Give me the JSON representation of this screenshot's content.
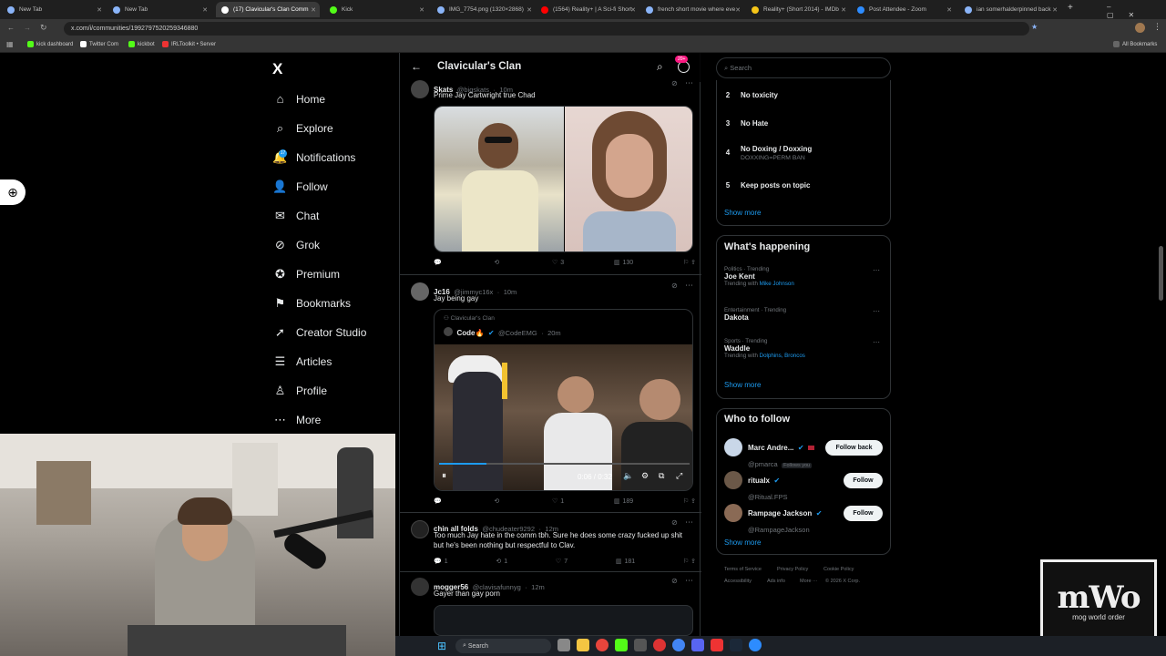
{
  "browser": {
    "tabs": [
      {
        "title": "New Tab",
        "color": "#8ab4f8"
      },
      {
        "title": "New Tab",
        "color": "#8ab4f8"
      },
      {
        "title": "(17) Clavicular's Clan Comm",
        "color": "#ffffff"
      },
      {
        "title": "Kick",
        "color": "#53fc18"
      },
      {
        "title": "IMG_7754.png (1320×2868)",
        "color": "#8ab4f8"
      },
      {
        "title": "(1564) Reality+ | A Sci-fi Short",
        "color": "#ff0000"
      },
      {
        "title": "french short movie where eve",
        "color": "#8ab4f8"
      },
      {
        "title": "Reality+ (Short 2014) - IMDb",
        "color": "#f5c518"
      },
      {
        "title": "Post Attendee - Zoom",
        "color": "#2d8cff"
      },
      {
        "title": "ian somerhalderpinned back",
        "color": "#8ab4f8"
      }
    ],
    "url": "x.com/i/communities/1992797520259346880",
    "bookmarks": [
      "kick dashboard",
      "Twitter Com",
      "kickbot",
      "IRLToolkit • Server"
    ],
    "all_bookmarks": "All Bookmarks"
  },
  "nav": {
    "logo": "X",
    "items": [
      {
        "label": "Home",
        "icon": "home-icon",
        "glyph": "⌂"
      },
      {
        "label": "Explore",
        "icon": "search-icon",
        "glyph": "⌕"
      },
      {
        "label": "Notifications",
        "icon": "bell-icon",
        "glyph": "🔔"
      },
      {
        "label": "Follow",
        "icon": "person-plus-icon",
        "glyph": "👤"
      },
      {
        "label": "Chat",
        "icon": "mail-icon",
        "glyph": "✉"
      },
      {
        "label": "Grok",
        "icon": "grok-icon",
        "glyph": "⊘"
      },
      {
        "label": "Premium",
        "icon": "verified-icon",
        "glyph": "✪"
      },
      {
        "label": "Bookmarks",
        "icon": "bookmark-icon",
        "glyph": "⚑"
      },
      {
        "label": "Creator Studio",
        "icon": "rocket-icon",
        "glyph": "➚"
      },
      {
        "label": "Articles",
        "icon": "document-icon",
        "glyph": "☰"
      },
      {
        "label": "Profile",
        "icon": "person-icon",
        "glyph": "♙"
      },
      {
        "label": "More",
        "icon": "more-icon",
        "glyph": "⋯"
      }
    ],
    "notifications_badge": "17"
  },
  "header": {
    "title": "Clavicular's Clan",
    "badge": "20+"
  },
  "posts": [
    {
      "name": "Skats",
      "handle": "@bigskats",
      "time": "10m",
      "text": "Prime Jay Cartwright true Chad",
      "replies": "",
      "reposts": "",
      "likes": "3",
      "views": "130"
    },
    {
      "name": "Jc16",
      "handle": "@jimmyc16x",
      "time": "10m",
      "text": "Jay being gay",
      "replies": "",
      "reposts": "",
      "likes": "1",
      "views": "189",
      "quote": {
        "community": "Clavicular's Clan",
        "name": "Code🔥",
        "handle": "@CodeEMG",
        "time": "20m",
        "video_time": "0:06 / 0:32"
      }
    },
    {
      "name": "chin all folds",
      "handle": "@chudeater9292",
      "time": "12m",
      "text": "Too much Jay hate in the comm tbh. Sure he does some crazy fucked up shit but he's been nothing but respectful to Clav.",
      "replies": "1",
      "reposts": "1",
      "likes": "7",
      "views": "181"
    },
    {
      "name": "mogger56",
      "handle": "@clavisafunnyg",
      "time": "12m",
      "text": "Gayer than gay porn"
    }
  ],
  "sidebar": {
    "search_placeholder": "Search",
    "rules": [
      {
        "n": "2",
        "title": "No toxicity",
        "sub": ""
      },
      {
        "n": "3",
        "title": "No Hate",
        "sub": ""
      },
      {
        "n": "4",
        "title": "No Doxing / Doxxing",
        "sub": "DOXXING=PERM BAN"
      },
      {
        "n": "5",
        "title": "Keep posts on topic",
        "sub": ""
      }
    ],
    "show_more": "Show more",
    "happening_title": "What's happening",
    "trends": [
      {
        "meta": "Politics · Trending",
        "name": "Joe Kent",
        "with_label": "Trending with ",
        "with": "Mike Johnson"
      },
      {
        "meta": "Entertainment · Trending",
        "name": "Dakota",
        "with_label": "",
        "with": ""
      },
      {
        "meta": "Sports · Trending",
        "name": "Waddle",
        "with_label": "Trending with ",
        "with": "Dolphins, Broncos"
      }
    ],
    "who_title": "Who to follow",
    "who": [
      {
        "name": "Marc Andre...",
        "handle": "@pmarca",
        "extra": "Follows you",
        "button": "Follow back"
      },
      {
        "name": "ritualx",
        "handle": "@Ritual.FPS",
        "extra": "",
        "button": "Follow"
      },
      {
        "name": "Rampage Jackson",
        "handle": "@RampageJackson",
        "extra": "",
        "button": "Follow"
      }
    ],
    "footer": [
      "Terms of Service",
      "Privacy Policy",
      "Cookie Policy",
      "Accessibility",
      "Ads info",
      "More ···",
      "© 2026 X Corp."
    ]
  },
  "overlay": {
    "logo_text": "mWo",
    "logo_sub": "mog world order"
  },
  "taskbar": {
    "search": "Search"
  }
}
